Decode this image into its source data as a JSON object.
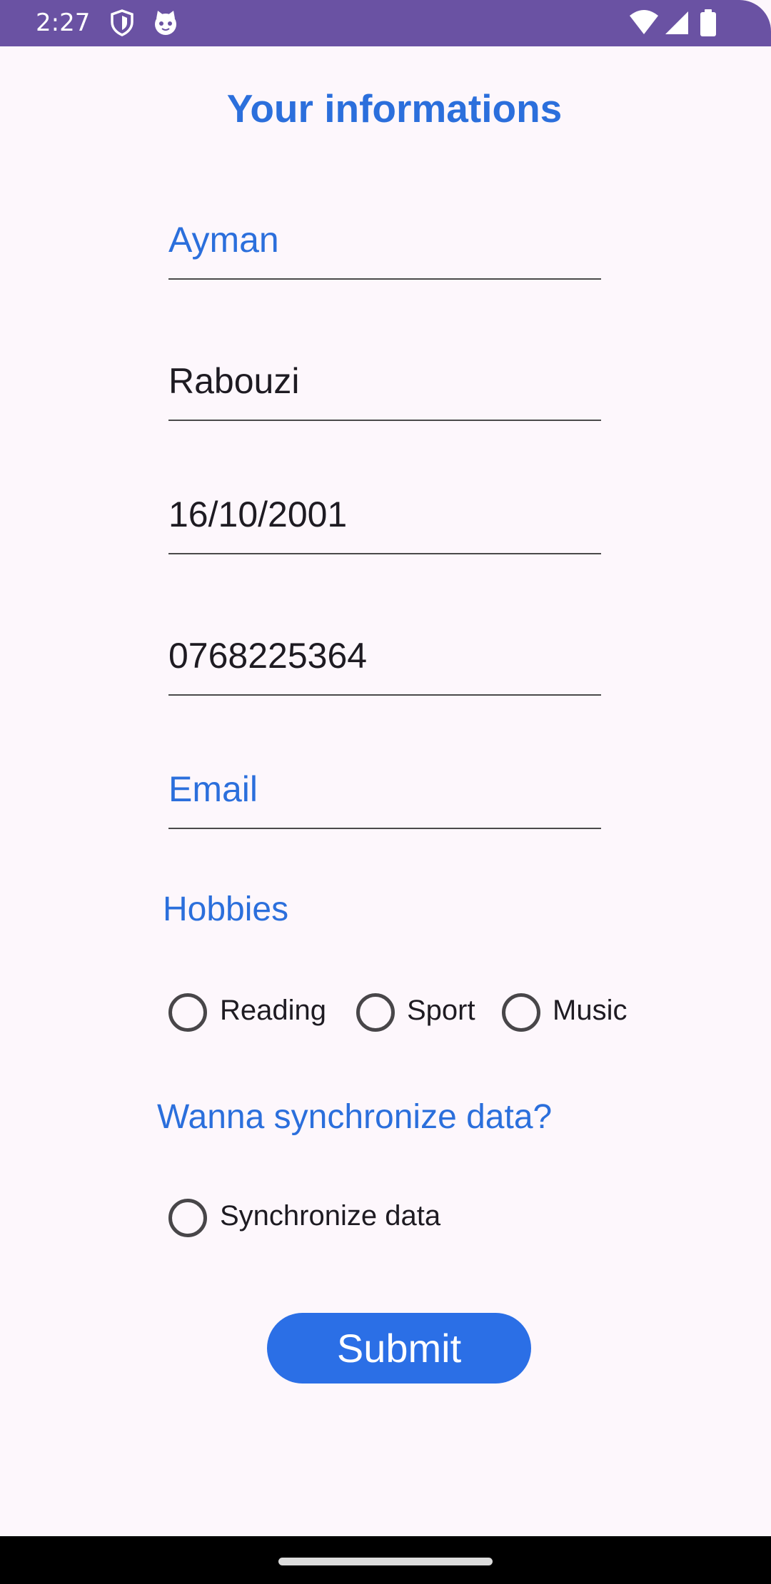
{
  "status_bar": {
    "time": "2:27",
    "icons": [
      "shield-icon",
      "cat-face-icon",
      "wifi-icon",
      "signal-icon",
      "battery-icon"
    ],
    "background_color": "#6a52a3"
  },
  "form": {
    "title": "Your informations",
    "fields": [
      {
        "name": "first-name",
        "text": "Ayman",
        "state": "hint"
      },
      {
        "name": "last-name",
        "text": "Rabouzi",
        "state": "value"
      },
      {
        "name": "birth-date",
        "text": "16/10/2001",
        "state": "value"
      },
      {
        "name": "phone",
        "text": "0768225364",
        "state": "value"
      },
      {
        "name": "email",
        "text": "Email",
        "state": "hint"
      }
    ],
    "hobbies": {
      "label": "Hobbies",
      "options": [
        {
          "label": "Reading",
          "checked": false
        },
        {
          "label": "Sport",
          "checked": false
        },
        {
          "label": "Music",
          "checked": false
        }
      ]
    },
    "sync": {
      "label": "Wanna synchronize data?",
      "option": {
        "label": "Synchronize data",
        "checked": false
      }
    },
    "submit_label": "Submit"
  },
  "colors": {
    "accent": "#2b6fdc",
    "button": "#2b6fe6",
    "background": "#fdf7fc",
    "text": "#1e1b22"
  }
}
